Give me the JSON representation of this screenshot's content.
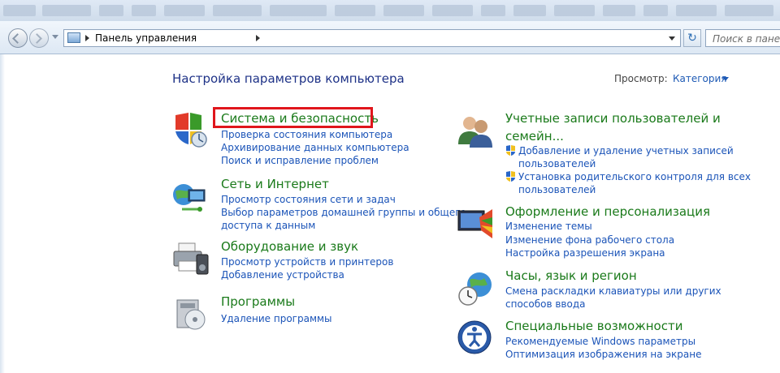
{
  "address": {
    "path": "Панель управления",
    "search_placeholder": "Поиск в панели"
  },
  "header": {
    "title": "Настройка параметров компьютера",
    "view_label": "Просмотр:",
    "view_value": "Категория"
  },
  "categories": {
    "system": {
      "title": "Система и безопасность",
      "links": [
        "Проверка состояния компьютера",
        "Архивирование данных компьютера",
        "Поиск и исправление проблем"
      ]
    },
    "network": {
      "title": "Сеть и Интернет",
      "links": [
        "Просмотр состояния сети и задач",
        "Выбор параметров домашней группы и общего",
        "доступа к данным"
      ]
    },
    "hardware": {
      "title": "Оборудование и звук",
      "links": [
        "Просмотр устройств и принтеров",
        "Добавление устройства"
      ]
    },
    "programs": {
      "title": "Программы",
      "links": [
        "Удаление программы"
      ]
    },
    "users": {
      "title_line1": "Учетные записи пользователей и",
      "title_line2": "семейн...",
      "links": [
        "Добавление и удаление учетных записей",
        "пользователей",
        "Установка родительского контроля для всех",
        "пользователей"
      ]
    },
    "appearance": {
      "title": "Оформление и персонализация",
      "links": [
        "Изменение темы",
        "Изменение фона рабочего стола",
        "Настройка разрешения экрана"
      ]
    },
    "clock": {
      "title": "Часы, язык и регион",
      "links": [
        "Смена раскладки клавиатуры или других",
        "способов ввода"
      ]
    },
    "access": {
      "title": "Специальные возможности",
      "links": [
        "Рекомендуемые Windows параметры",
        "Оптимизация изображения на экране"
      ]
    }
  },
  "colors": {
    "title_green": "#1a7a1a",
    "link_blue": "#1b54b8",
    "heading_blue": "#1e3287",
    "highlight_red": "#e0161c"
  }
}
